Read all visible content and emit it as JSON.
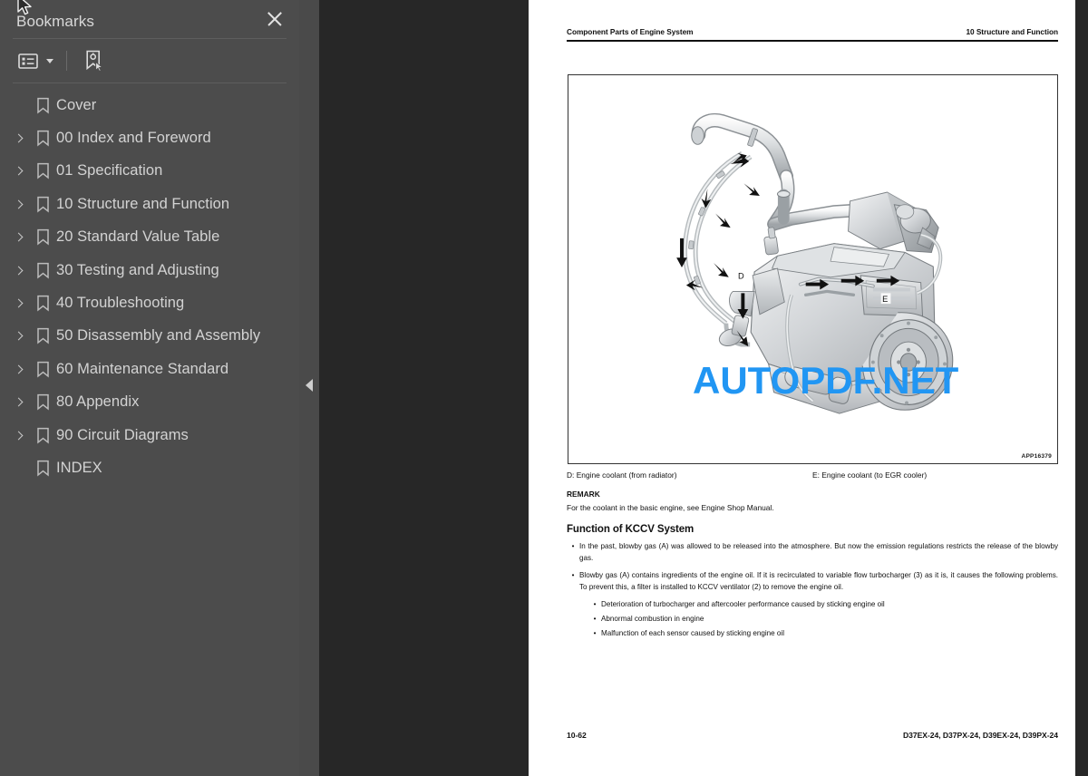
{
  "sidebar": {
    "title": "Bookmarks",
    "close_icon": "close-icon",
    "toolbar": {
      "list_options_icon": "list-options-icon",
      "caret_icon": "chevron-down-icon",
      "new_bookmark_icon": "new-bookmark-icon"
    },
    "items": [
      {
        "label": "Cover",
        "expandable": false
      },
      {
        "label": "00 Index and Foreword",
        "expandable": true
      },
      {
        "label": "01 Specification",
        "expandable": true
      },
      {
        "label": "10 Structure and Function",
        "expandable": true
      },
      {
        "label": "20 Standard Value Table",
        "expandable": true
      },
      {
        "label": "30 Testing and Adjusting",
        "expandable": true
      },
      {
        "label": "40 Troubleshooting",
        "expandable": true
      },
      {
        "label": "50 Disassembly and Assembly",
        "expandable": true
      },
      {
        "label": "60 Maintenance Standard",
        "expandable": true
      },
      {
        "label": "80 Appendix",
        "expandable": true
      },
      {
        "label": "90 Circuit Diagrams",
        "expandable": true
      },
      {
        "label": "INDEX",
        "expandable": false
      }
    ]
  },
  "handle": {
    "icon": "collapse-panel-arrow-icon"
  },
  "watermark": {
    "text": "AUTOPDF.NET",
    "color": "#2196f3"
  },
  "page": {
    "header_left": "Component Parts of Engine System",
    "header_right": "10 Structure and Function",
    "figure": {
      "code": "APP16379",
      "alt": "engine-assembly-illustration",
      "callouts": [
        "D",
        "E"
      ]
    },
    "caption_left": "D: Engine coolant (from radiator)",
    "caption_right": "E: Engine coolant (to EGR cooler)",
    "remark_heading": "REMARK",
    "remark_text": "For the coolant in the basic engine, see Engine Shop Manual.",
    "section_heading": "Function of KCCV System",
    "bullets": [
      "In the past, blowby gas (A) was allowed to be released into the atmosphere. But now the emission regulations restricts the release of the blowby gas.",
      "Blowby gas (A) contains ingredients of the engine oil. If it is recirculated to variable flow turbocharger (3) as it is, it causes the following problems. To prevent this, a filter is installed to KCCV ventilator (2) to remove the engine oil."
    ],
    "sub_bullets": [
      "Deterioration of turbocharger and aftercooler performance caused by sticking engine oil",
      "Abnormal combustion in engine",
      "Malfunction of each sensor caused by sticking engine oil"
    ],
    "footer_left": "10-62",
    "footer_right": "D37EX-24, D37PX-24, D39EX-24, D39PX-24"
  },
  "cursor": {
    "icon": "mouse-pointer-icon"
  }
}
